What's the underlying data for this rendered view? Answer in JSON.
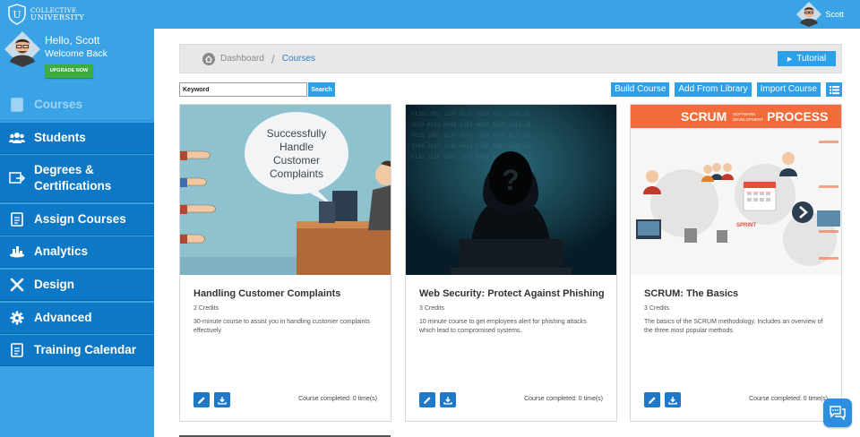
{
  "logo": {
    "line1": "COLLECTIVE",
    "line2": "UNIVERSITY",
    "letter": "U"
  },
  "top_user": {
    "name": "Scott"
  },
  "welcome": {
    "hello": "Hello, Scott",
    "subtitle": "Welcome Back",
    "upgrade_label": "UPGRADE NOW"
  },
  "nav": {
    "items": [
      {
        "label": "Courses",
        "icon": "notebook-icon",
        "active": true
      },
      {
        "label": "Students",
        "icon": "users-icon"
      },
      {
        "label": "Degrees &",
        "label2": "Certifications",
        "icon": "certificate-icon"
      },
      {
        "label": "Assign Courses",
        "icon": "assign-icon"
      },
      {
        "label": "Analytics",
        "icon": "analytics-icon"
      },
      {
        "label": "Design",
        "icon": "design-tools-icon"
      },
      {
        "label": "Advanced",
        "icon": "gear-icon"
      },
      {
        "label": "Training Calendar",
        "icon": "calendar-icon"
      }
    ]
  },
  "breadcrumb": {
    "home": "Dashboard",
    "separator": "/",
    "current": "Courses"
  },
  "tutorial": {
    "label": "Tutorial"
  },
  "search": {
    "placeholder": "Keyword",
    "button": "Search"
  },
  "actions": {
    "build": "Build Course",
    "library": "Add From Library",
    "import": "Import Course"
  },
  "courses": [
    {
      "title": "Handling Customer Complaints",
      "credits": "2 Credits",
      "description": "30-minute course to assist you in handling customer complaints effectively",
      "completed": "Course completed: 0 time(s)",
      "image_text": [
        "Successfully",
        "Handle",
        "Customer",
        "Complaints"
      ]
    },
    {
      "title": "Web Security: Protect Against Phishing",
      "credits": "3 Credits",
      "description": "10 minute course to get employees alert for phishing attacks which lead to compromised systems.",
      "completed": "Course completed: 0 time(s)",
      "image_text": [
        "?"
      ]
    },
    {
      "title": "SCRUM: The Basics",
      "credits": "3 Credits",
      "description": "The basics of the SCRUM methodology. Includes an overview of the three most popular methods.",
      "completed": "Course completed: 0 time(s)",
      "image_text": [
        "SCRUM",
        "SOFTWARE",
        "DEVELOPMENT",
        "PROCESS",
        "SPRINT"
      ]
    }
  ],
  "colors": {
    "brand_blue": "#3aa3e6",
    "nav_blue": "#0c78c6",
    "button_blue": "#2ea0e8",
    "upgrade_green": "#3cae41",
    "scrum_orange": "#f26b3a"
  }
}
